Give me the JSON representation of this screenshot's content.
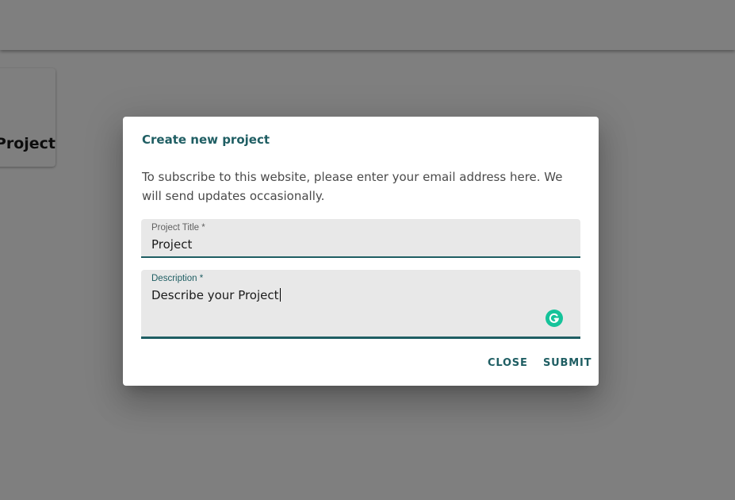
{
  "background": {
    "project_card_label": "Project"
  },
  "dialog": {
    "title": "Create new project",
    "description_text": "To subscribe to this website, please enter your email address here. We will send updates occasionally.",
    "fields": {
      "title": {
        "label": "Project Title *",
        "value": "Project"
      },
      "description": {
        "label": "Description *",
        "value": "Describe your Project"
      }
    },
    "actions": {
      "close_label": "CLOSE",
      "submit_label": "SUBMIT"
    }
  },
  "icons": {
    "grammarly": "grammarly-icon"
  },
  "colors": {
    "accent": "#1f5e63",
    "grammarly": "#15c39a",
    "field_background": "#e8e8e8",
    "backdrop": "rgba(0,0,0,0.5)"
  }
}
